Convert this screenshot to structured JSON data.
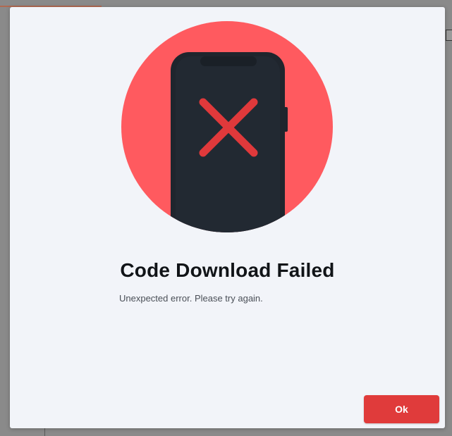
{
  "dialog": {
    "title": "Code Download Failed",
    "message": "Unexpected error. Please try again.",
    "ok_label": "Ok",
    "illustration_icon": "phone-error-icon"
  },
  "colors": {
    "accent": "#e03b3b",
    "illustration_circle": "#ff5a5f",
    "phone_body": "#1f252d",
    "error_cross": "#e0393b",
    "dialog_background": "#f2f4f9"
  }
}
